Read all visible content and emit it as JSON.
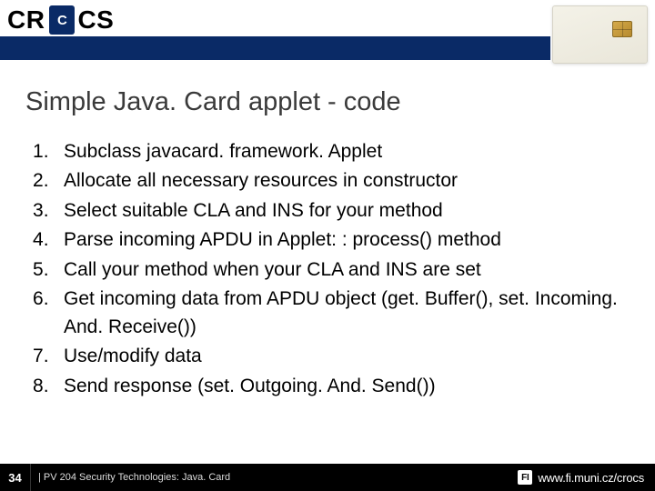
{
  "header": {
    "logo_left": "CR",
    "logo_shield": "C",
    "logo_right": "CS"
  },
  "title": "Simple Java. Card applet - code",
  "steps": [
    "Subclass javacard. framework. Applet",
    "Allocate all necessary resources in constructor",
    "Select suitable CLA and INS for your method",
    "Parse incoming APDU in Applet: : process() method",
    "Call your method when your CLA and INS are set",
    "Get incoming data from APDU object (get. Buffer(), set. Incoming. And. Receive())",
    "Use/modify data",
    "Send response (set. Outgoing. And. Send())"
  ],
  "footer": {
    "slide_number": "34",
    "course": "| PV 204 Security Technologies: Java. Card",
    "site": "www.fi.muni.cz/crocs",
    "mark": "FI"
  }
}
